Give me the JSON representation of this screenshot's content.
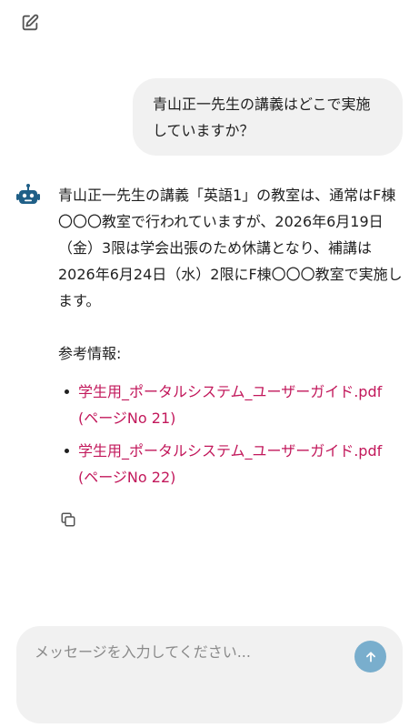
{
  "header": {
    "new_chat_icon": "edit-icon"
  },
  "conversation": {
    "user_message": "青山正一先生の講義はどこで実施していますか？",
    "bot_avatar_icon": "robot-icon",
    "bot_message": "青山正一先生の講義「英語1」の教室は、通常はF棟〇〇〇教室で行われていますが、2026年6月19日（金）3限は学会出張のため休講となり、補講は2026年6月24日（水）2限にF棟〇〇〇教室で実施します。",
    "references_label": "参考情報:",
    "references": [
      {
        "text": "学生用_ポータルシステム_ユーザーガイド.pdf (ページNo 21)"
      },
      {
        "text": "学生用_ポータルシステム_ユーザーガイド.pdf (ページNo 22)"
      }
    ],
    "copy_icon": "copy-icon"
  },
  "composer": {
    "placeholder": "メッセージを入力してください...",
    "value": "",
    "send_icon": "arrow-up-icon"
  },
  "colors": {
    "link": "#c2185b",
    "bubble_bg": "#f1f1f1",
    "send_button": "#79aecd",
    "avatar": "#1f5f87"
  }
}
